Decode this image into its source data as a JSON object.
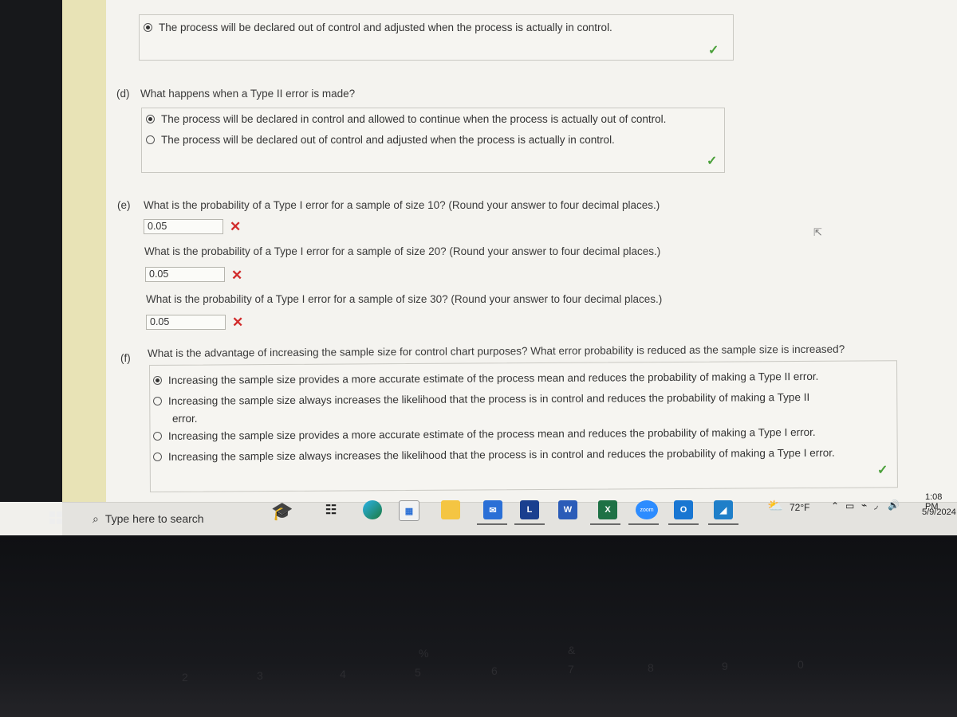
{
  "question_c_tail": {
    "option_text": "The process will be declared out of control and adjusted when the process is actually in control.",
    "selected": true,
    "status": "correct"
  },
  "question_d": {
    "label": "(d)",
    "prompt": "What happens when a Type II error is made?",
    "options": [
      {
        "text": "The process will be declared in control and allowed to continue when the process is actually out of control.",
        "selected": true
      },
      {
        "text": "The process will be declared out of control and adjusted when the process is actually in control.",
        "selected": false
      }
    ],
    "status": "correct"
  },
  "question_e": {
    "label": "(e)",
    "parts": [
      {
        "prompt": "What is the probability of a Type I error for a sample of size 10? (Round your answer to four decimal places.)",
        "value": "0.05",
        "status": "incorrect"
      },
      {
        "prompt": "What is the probability of a Type I error for a sample of size 20? (Round your answer to four decimal places.)",
        "value": "0.05",
        "status": "incorrect"
      },
      {
        "prompt": "What is the probability of a Type I error for a sample of size 30? (Round your answer to four decimal places.)",
        "value": "0.05",
        "status": "incorrect"
      }
    ]
  },
  "question_f": {
    "label": "(f)",
    "prompt": "What is the advantage of increasing the sample size for control chart purposes? What error probability is reduced as the sample size is increased?",
    "options": [
      {
        "text": "Increasing the sample size provides a more accurate estimate of the process mean and reduces the probability of making a Type II error.",
        "selected": true
      },
      {
        "text": "Increasing the sample size always increases the likelihood that the process is in control and reduces the probability of making a Type II",
        "text_cont": "error.",
        "selected": false
      },
      {
        "text": "Increasing the sample size provides a more accurate estimate of the process mean and reduces the probability of making a Type I error.",
        "selected": false
      },
      {
        "text": "Increasing the sample size always increases the likelihood that the process is in control and reduces the probability of making a Type I error.",
        "selected": false
      }
    ],
    "status": "correct"
  },
  "symbols": {
    "check": "✓",
    "cross": "✕",
    "search": "⚲",
    "cursor": "⇱"
  },
  "taskbar": {
    "search_placeholder": "Type here to search",
    "apps": [
      "graduation-cap",
      "task-view",
      "edge",
      "store",
      "file-explorer",
      "mail",
      "L",
      "W",
      "X",
      "zoom",
      "outlook-new",
      "photos"
    ],
    "app_labels": {
      "L": "L",
      "W": "W",
      "X": "X",
      "zoom": "zoom",
      "outlook": "O"
    },
    "weather": "72°F",
    "time": "1:08 PM",
    "date": "5/9/2024"
  },
  "keyboard_keys": [
    "2",
    "3",
    "4",
    "5",
    "6",
    "7",
    "8",
    "9",
    "0",
    "%",
    "&"
  ]
}
